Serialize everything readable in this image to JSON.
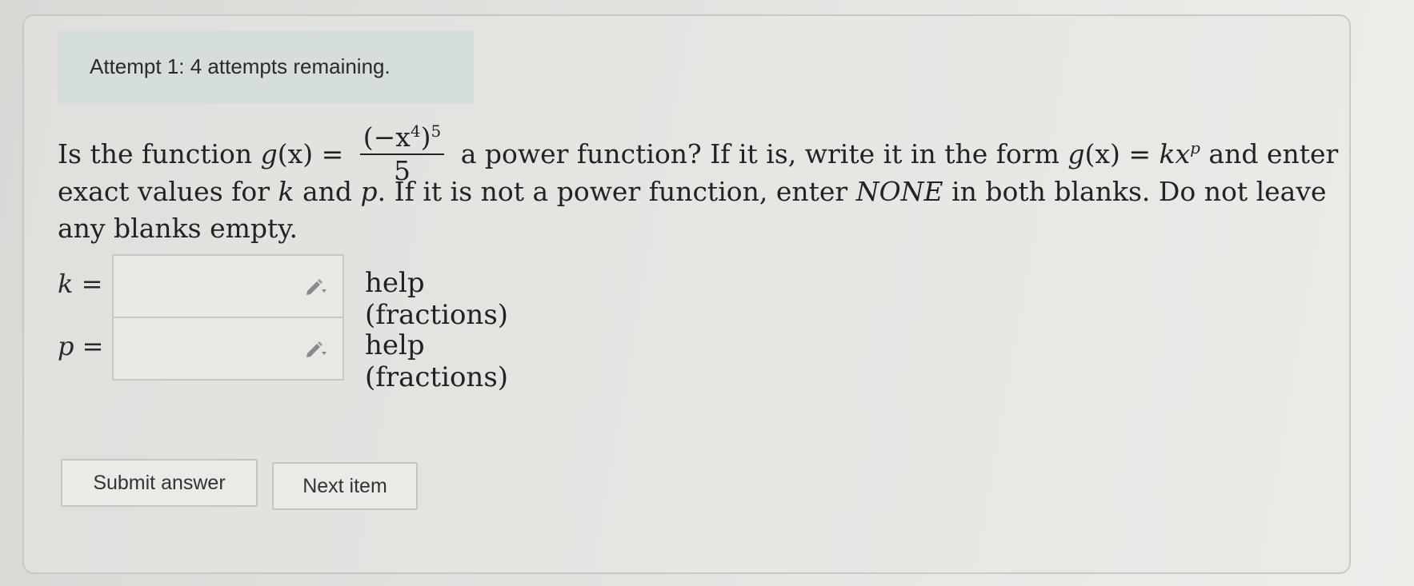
{
  "attempt": {
    "text": "Attempt 1: 4 attempts remaining."
  },
  "question": {
    "part1": "Is the function ",
    "g": "g",
    "x_paren": "(x) =",
    "num_open": "(−x",
    "num_exp_inner": "4",
    "num_close": ")",
    "num_exp_outer": "5",
    "den": "5",
    "part2": " a power function? If it is, write it in the form ",
    "form_g": "g",
    "form_x": "(x) = ",
    "form_kx": "kx",
    "form_p": "p",
    "part3": " and enter",
    "line2a": "exact values for ",
    "line2_k": "k",
    "line2b": " and ",
    "line2_p": "p",
    "line2c": ". If it is not a power function, enter ",
    "line2_none": "NONE",
    "line2d": " in both blanks. Do not leave",
    "line3": "any blanks empty."
  },
  "fields": [
    {
      "label": "k =",
      "value": "",
      "help": "help (fractions)",
      "icon": "pencil-icon"
    },
    {
      "label": "p =",
      "value": "",
      "help": "help (fractions)",
      "icon": "pencil-icon"
    }
  ],
  "buttons": {
    "submit": "Submit answer",
    "next": "Next item"
  }
}
